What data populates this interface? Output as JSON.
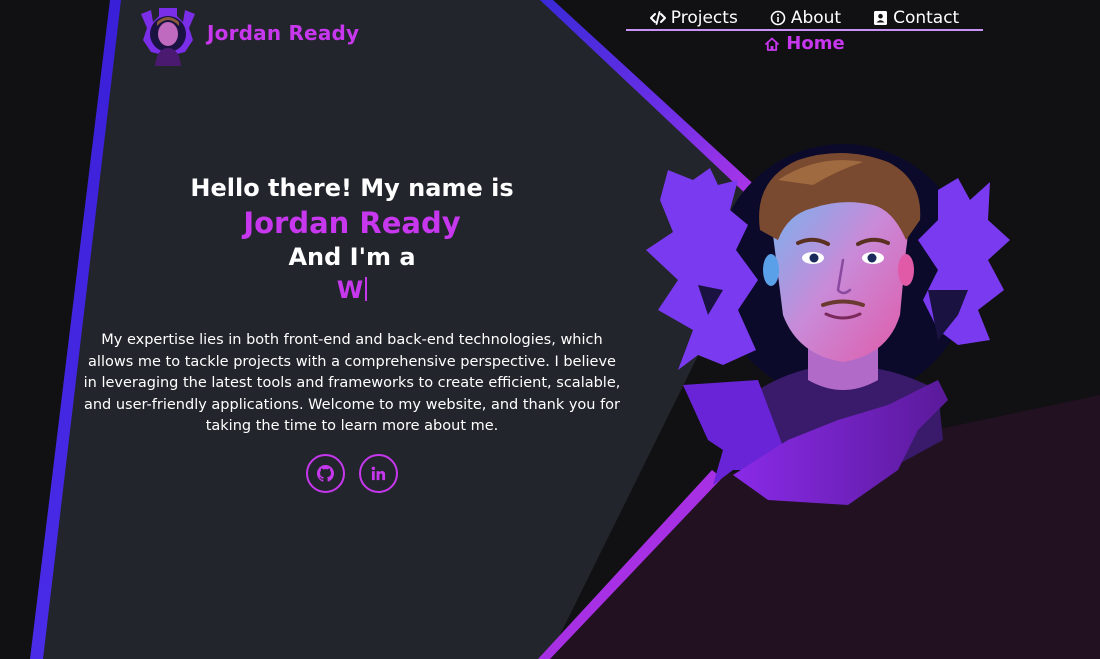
{
  "brand": {
    "name": "Jordan Ready"
  },
  "nav": {
    "links": [
      {
        "label": "Projects",
        "icon": "code-icon"
      },
      {
        "label": "About",
        "icon": "info-circle-icon"
      },
      {
        "label": "Contact",
        "icon": "contact-card-icon"
      }
    ],
    "active": {
      "label": "Home",
      "icon": "home-icon"
    }
  },
  "hero": {
    "greeting": "Hello there! My name is",
    "name": "Jordan Ready",
    "role_intro": "And I'm a",
    "typed_text": "W",
    "bio": "My expertise lies in both front-end and back-end technologies, which allows me to tackle projects with a comprehensive perspective. I believe in leveraging the latest tools and frameworks to create efficient, scalable, and user-friendly applications. Welcome to my website, and thank you for taking the time to learn more about me."
  },
  "socials": [
    {
      "name": "github",
      "icon": "github-icon"
    },
    {
      "name": "linkedin",
      "icon": "linkedin-icon"
    }
  ],
  "colors": {
    "accent": "#c737ee",
    "background": "#111113",
    "panel": "#22252c",
    "blue_stripe": "#4127e0",
    "purple_stripe": "#a02ee0",
    "dark_purple_panel": "#211121",
    "nav_underline": "#c793f5"
  }
}
